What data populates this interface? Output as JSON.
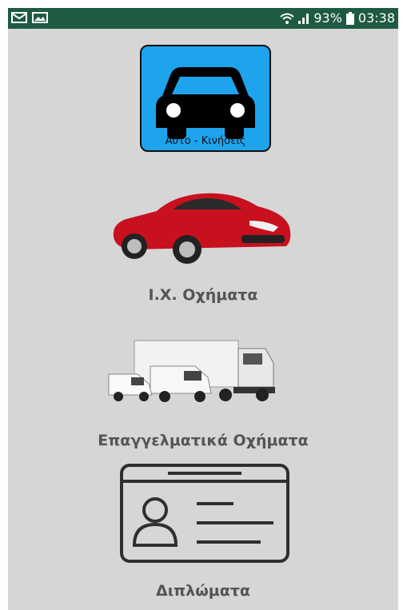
{
  "status_bar": {
    "left_icons": [
      "mail-icon",
      "image-icon"
    ],
    "right_icons": [
      "wifi-icon",
      "signal-icon",
      "battery-icon"
    ],
    "battery": "93%",
    "time": "03:38"
  },
  "colors": {
    "status_bar": "#1f5a43",
    "background": "#d6d6d6",
    "tile": "#1ea4ec",
    "label": "#555555"
  },
  "app_tile": {
    "caption": "Αυτο - Κινήσεις",
    "icon": "car-icon"
  },
  "menu": [
    {
      "label": "Ι.Χ. Οχήματα",
      "icon": "passenger-car-icon"
    },
    {
      "label": "Επαγγελματικά Οχήματα",
      "icon": "commercial-vehicles-icon"
    },
    {
      "label": "Διπλώματα",
      "icon": "license-card-icon"
    }
  ]
}
